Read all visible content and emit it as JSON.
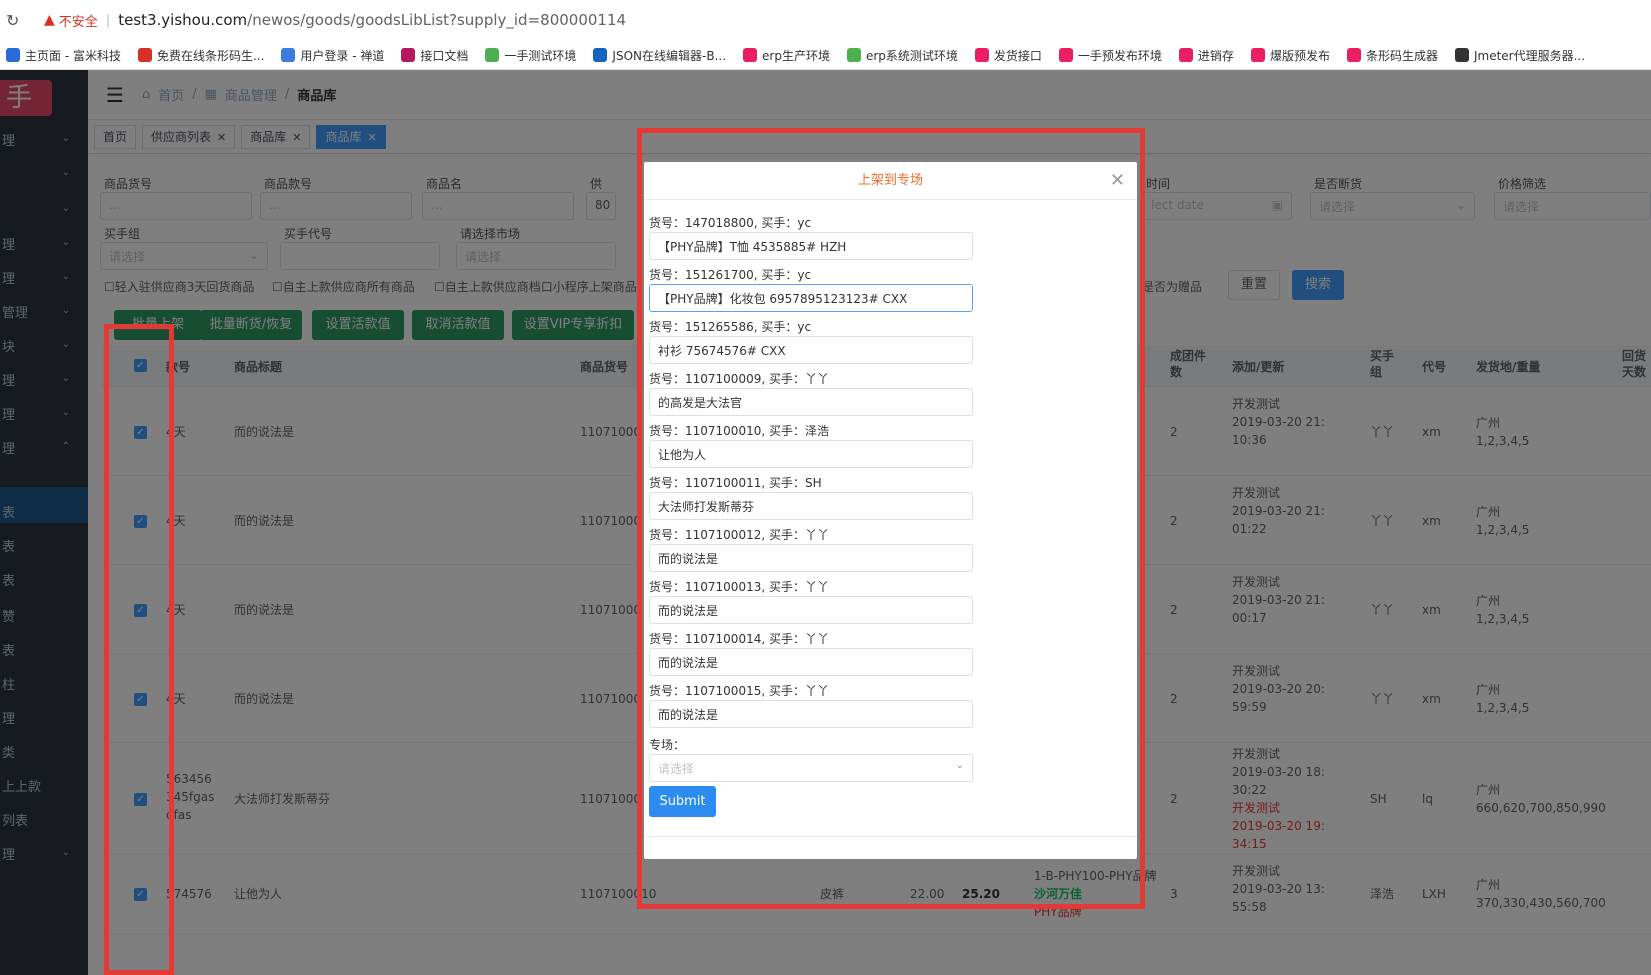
{
  "browser": {
    "insecure_label": "不安全",
    "url_host": "test3.yishou.com",
    "url_path": "/newos/goods/goodsLibList?supply_id=800000114",
    "bookmarks": [
      {
        "label": "主页面 - 富米科技",
        "color": "#2a6cd6"
      },
      {
        "label": "免费在线条形码生...",
        "color": "#d93025"
      },
      {
        "label": "用户登录 - 禅道",
        "color": "#3b7ddd"
      },
      {
        "label": "接口文档",
        "color": "#b5195b"
      },
      {
        "label": "一手测试环境",
        "color": "#4caf50"
      },
      {
        "label": "JSON在线编辑器-B...",
        "color": "#1565c0"
      },
      {
        "label": "erp生产环境",
        "color": "#e91e63"
      },
      {
        "label": "erp系统测试环境",
        "color": "#4caf50"
      },
      {
        "label": "发货接口",
        "color": "#e91e63"
      },
      {
        "label": "一手预发布环境",
        "color": "#e91e63"
      },
      {
        "label": "进销存",
        "color": "#e91e63"
      },
      {
        "label": "爆版预发布",
        "color": "#e91e63"
      },
      {
        "label": "条形码生成器",
        "color": "#e91e63"
      },
      {
        "label": "Jmeter代理服务器...",
        "color": "#333333"
      }
    ]
  },
  "sidebar": {
    "logo": "手",
    "items": [
      "理",
      "",
      "",
      "理",
      "理",
      "管理",
      "块",
      "理",
      "理",
      "理",
      "",
      "表",
      "表",
      "表",
      "赞",
      "表",
      "柱",
      "理",
      "类",
      "上上款",
      "列表",
      "理"
    ]
  },
  "topnav": {
    "home": "首页",
    "goods_mgmt": "商品管理",
    "current": "商品库"
  },
  "tabs": [
    {
      "label": "首页",
      "closable": false,
      "active": false
    },
    {
      "label": "供应商列表",
      "closable": true,
      "active": false
    },
    {
      "label": "商品库",
      "closable": true,
      "active": false
    },
    {
      "label": "商品库",
      "closable": true,
      "active": true
    }
  ],
  "filters": {
    "labels": [
      "商品货号",
      "商品款号",
      "商品名",
      "供",
      "时间",
      "是否断货",
      "价格筛选",
      "买手组",
      "买手代号",
      "请选择市场"
    ],
    "placeholder_select": "请选择",
    "placeholder_date": "lect date",
    "supply_value": "80",
    "checkboxes": [
      "轻入驻供应商3天回货商品",
      "自主上款供应商所有商品",
      "自主上款供应商档口小程序上架商品"
    ],
    "gift_label": "是否为赠品",
    "reset": "重置",
    "search": "搜索"
  },
  "actions": [
    "批量上架",
    "批量断货/恢复",
    "设置活款值",
    "取消活款值",
    "设置VIP专享折扣"
  ],
  "table": {
    "headers": [
      "款号",
      "商品标题",
      "商品货号",
      "成团件数",
      "添加/更新",
      "买手组",
      "代号",
      "发货地/重量",
      "回货天数"
    ],
    "rows": [
      {
        "style_no": "4天",
        "title": "而的说法是",
        "goods_no": "11071000",
        "group": "2",
        "added": "开发测试",
        "time": "2019-03-20 21:10:36",
        "buyer": "丫丫",
        "code": "xm",
        "ship": "广州",
        "weight": "1,2,3,4,5"
      },
      {
        "style_no": "4天",
        "title": "而的说法是",
        "goods_no": "11071000",
        "group": "2",
        "added": "开发测试",
        "time": "2019-03-20 21:01:22",
        "buyer": "丫丫",
        "code": "xm",
        "ship": "广州",
        "weight": "1,2,3,4,5"
      },
      {
        "style_no": "4天",
        "title": "而的说法是",
        "goods_no": "11071000",
        "group": "2",
        "added": "开发测试",
        "time": "2019-03-20 21:00:17",
        "buyer": "丫丫",
        "code": "xm",
        "ship": "广州",
        "weight": "1,2,3,4,5"
      },
      {
        "style_no": "4天",
        "title": "而的说法是",
        "goods_no": "11071000",
        "group": "2",
        "added": "开发测试",
        "time": "2019-03-20 20:59:59",
        "buyer": "丫丫",
        "code": "xm",
        "ship": "广州",
        "weight": "1,2,3,4,5"
      },
      {
        "style_no": "563456 345fgas dfas",
        "title": "大法师打发斯蒂芬",
        "goods_no": "11071000",
        "group": "2",
        "added": "开发测试",
        "time": "2019-03-20 18:30:22",
        "added2": "开发测试",
        "time2": "2019-03-20 19:34:15",
        "buyer": "SH",
        "code": "lq",
        "ship": "广州",
        "weight": "660,620,700,850,990"
      },
      {
        "style_no": "574576",
        "title": "让他为人",
        "goods_no": "1107100010",
        "category": "皮裤",
        "price": "22.00",
        "price2": "25.20",
        "market": "1-B-PHY100-PHY品牌",
        "market2": "沙河万佳",
        "brand": "PHY品牌",
        "group": "3",
        "added": "开发测试",
        "time": "2019-03-20 13:55:58",
        "buyer": "泽浩",
        "code": "LXH",
        "ship": "广州",
        "weight": "370,330,430,560,700"
      }
    ]
  },
  "modal": {
    "title": "上架到专场",
    "items": [
      {
        "label": "货号：147018800, 买手：yc",
        "value": "【PHY品牌】T恤 4535885# HZH"
      },
      {
        "label": "货号：151261700, 买手：yc",
        "value": "【PHY品牌】化妆包 6957895123123# CXX"
      },
      {
        "label": "货号：151265586, 买手：yc",
        "value": "衬衫 75674576# CXX"
      },
      {
        "label": "货号：1107100009, 买手：丫丫",
        "value": "的高发是大法官"
      },
      {
        "label": "货号：1107100010, 买手：泽浩",
        "value": "让他为人"
      },
      {
        "label": "货号：1107100011, 买手：SH",
        "value": "大法师打发斯蒂芬"
      },
      {
        "label": "货号：1107100012, 买手：丫丫",
        "value": "而的说法是"
      },
      {
        "label": "货号：1107100013, 买手：丫丫",
        "value": "而的说法是"
      },
      {
        "label": "货号：1107100014, 买手：丫丫",
        "value": "而的说法是"
      },
      {
        "label": "货号：1107100015, 买手：丫丫",
        "value": "而的说法是"
      }
    ],
    "special_label": "专场：",
    "special_placeholder": "请选择",
    "submit": "Submit"
  }
}
